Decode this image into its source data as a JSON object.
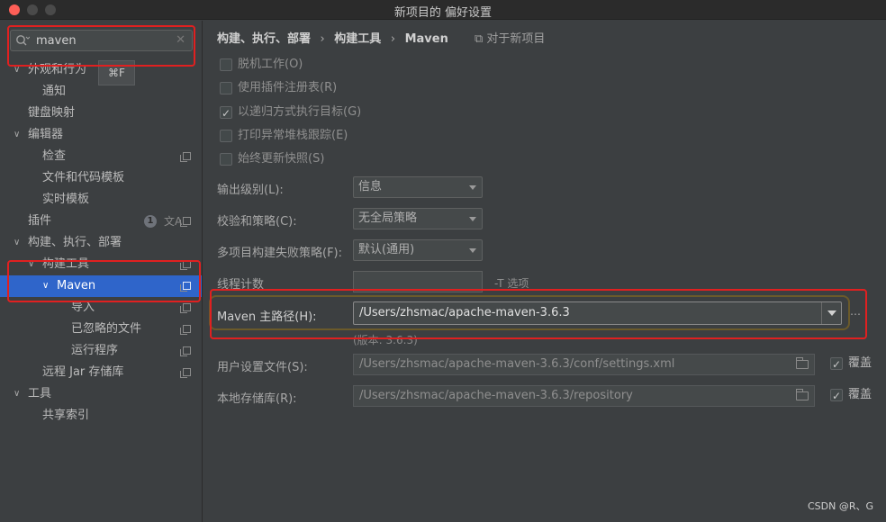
{
  "window": {
    "title": "新项目的 偏好设置"
  },
  "search": {
    "value": "maven",
    "shortcut": "⌘F"
  },
  "tree": [
    {
      "label": "外观和行为",
      "arrow": "∨"
    },
    {
      "label": "通知"
    },
    {
      "label": "键盘映射"
    },
    {
      "label": "编辑器",
      "arrow": "∨"
    },
    {
      "label": "检查"
    },
    {
      "label": "文件和代码模板"
    },
    {
      "label": "实时模板"
    },
    {
      "label": "插件",
      "badge": "1",
      "translate": "文A"
    },
    {
      "label": "构建、执行、部署",
      "arrow": "∨"
    },
    {
      "label": "构建工具",
      "arrow": "∨"
    },
    {
      "label": "Maven",
      "arrow": "∨"
    },
    {
      "label": "导入"
    },
    {
      "label": "已忽略的文件"
    },
    {
      "label": "运行程序"
    },
    {
      "label": "远程 Jar 存储库"
    },
    {
      "label": "工具",
      "arrow": "∨"
    },
    {
      "label": "共享索引"
    }
  ],
  "breadcrumb": {
    "part1": "构建、执行、部署",
    "sep": "›",
    "part2": "构建工具",
    "part3": "Maven",
    "for_new_project": "⧉ 对于新项目"
  },
  "checkboxes": [
    {
      "label": "脱机工作(O)",
      "checked": false
    },
    {
      "label": "使用插件注册表(R)",
      "checked": false
    },
    {
      "label": "以递归方式执行目标(G)",
      "checked": true
    },
    {
      "label": "打印异常堆栈跟踪(E)",
      "checked": false
    },
    {
      "label": "始终更新快照(S)",
      "checked": false
    }
  ],
  "fields": {
    "output_level_label": "输出级别(L):",
    "output_level_value": "信息",
    "checksum_label": "校验和策略(C):",
    "checksum_value": "无全局策略",
    "multiproject_label": "多项目构建失败策略(F):",
    "multiproject_value": "默认(通用)",
    "thread_label": "线程计数",
    "thread_value": "",
    "thread_suffix": "-T 选项",
    "maven_home_label": "Maven 主路径(H):",
    "maven_home_value": "/Users/zhsmac/apache-maven-3.6.3",
    "maven_home_more": "…",
    "version_text": "(版本: 3.6.3)",
    "user_settings_label": "用户设置文件(S):",
    "user_settings_value": "/Users/zhsmac/apache-maven-3.6.3/conf/settings.xml",
    "local_repo_label": "本地存储库(R):",
    "local_repo_value": "/Users/zhsmac/apache-maven-3.6.3/repository",
    "override_label": "覆盖"
  },
  "watermark": "CSDN @R、G",
  "colors": {
    "selection": "#2f65ca",
    "highlight_red": "#e02020"
  }
}
